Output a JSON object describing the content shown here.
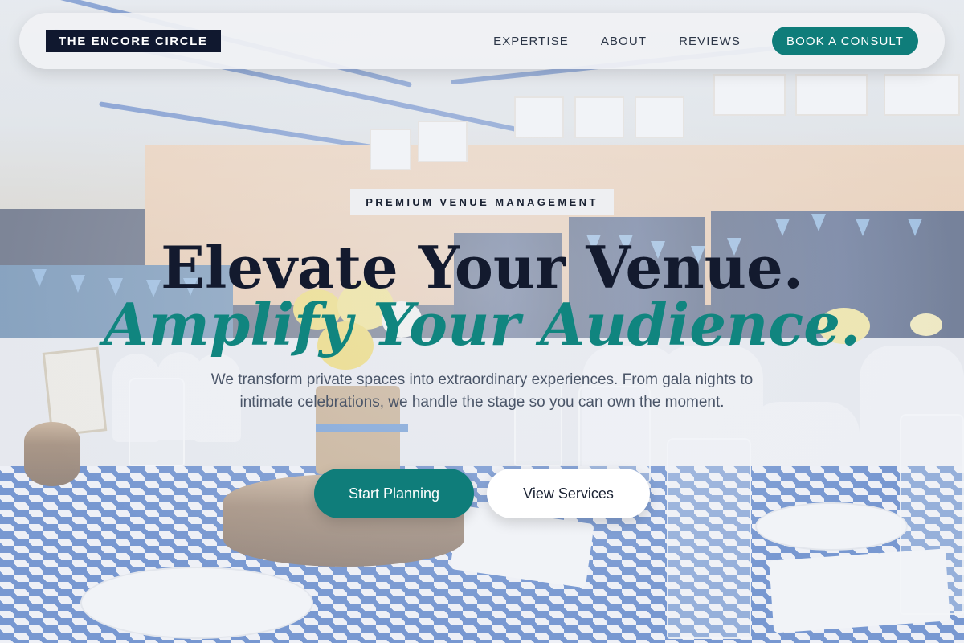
{
  "brand": {
    "name": "THE ENCORE CIRCLE"
  },
  "nav": {
    "links": [
      "EXPERTISE",
      "ABOUT",
      "REVIEWS"
    ],
    "cta_label": "BOOK A CONSULT"
  },
  "hero": {
    "eyebrow": "PREMIUM VENUE MANAGEMENT",
    "headline_line1": "Elevate Your Venue.",
    "headline_line2": "Amplify Your Audience.",
    "subtext": "We transform private spaces into extraordinary experiences. From gala nights to intimate celebrations, we handle the stage so you can own the moment.",
    "primary_button": "Start Planning",
    "secondary_button": "View Services"
  },
  "colors": {
    "accent": "#0f7d7a",
    "brand_dark": "#10182f",
    "headline_dark": "#131a2e",
    "headline_accent": "#10857f"
  }
}
